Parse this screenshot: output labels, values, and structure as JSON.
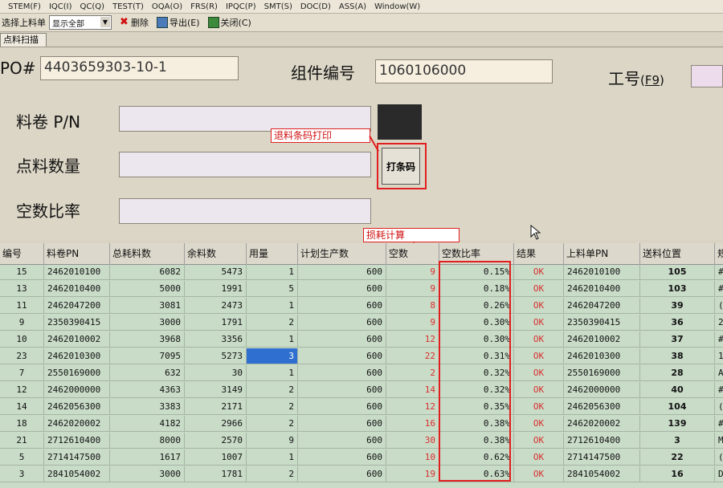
{
  "menu": [
    "STEM(F)",
    "IQC(I)",
    "QC(Q)",
    "TEST(T)",
    "OQA(O)",
    "FRS(R)",
    "IPQC(P)",
    "SMT(S)",
    "DOC(D)",
    "ASS(A)",
    "Window(W)"
  ],
  "toolbar": {
    "select_label": "选择上料单",
    "filter_value": "显示全部",
    "delete_label": "删除",
    "export_label": "导出(E)",
    "close_label": "关闭(C)"
  },
  "tab_label": "点料扫描",
  "form": {
    "po_label": "PO#",
    "po_value": "4403659303-10-1",
    "component_label": "组件编号",
    "component_value": "1060106000",
    "worker_label": "工号",
    "worker_hotkey": "F9",
    "reel_pn_label": "料卷 P/N",
    "count_label": "点料数量",
    "ratio_label": "空数比率",
    "print_button": "打条码"
  },
  "callouts": {
    "print_note": "退料条码打印",
    "calc_note": "损耗计算"
  },
  "table": {
    "headers": [
      "编号",
      "料卷PN",
      "总耗料数",
      "余料数",
      "用量",
      "计划生产数",
      "空数",
      "空数比率",
      "结果",
      "上料单PN",
      "送料位置",
      "规"
    ],
    "rows": [
      [
        "15",
        "2462010100",
        "6082",
        "5473",
        "1",
        "600",
        "9",
        "0.15%",
        "OK",
        "2462010100",
        "105",
        "#"
      ],
      [
        "13",
        "2462010400",
        "5000",
        "1991",
        "5",
        "600",
        "9",
        "0.18%",
        "OK",
        "2462010400",
        "103",
        "#"
      ],
      [
        "11",
        "2462047200",
        "3081",
        "2473",
        "1",
        "600",
        "8",
        "0.26%",
        "OK",
        "2462047200",
        "39",
        "("
      ],
      [
        "9",
        "2350390415",
        "3000",
        "1791",
        "2",
        "600",
        "9",
        "0.30%",
        "OK",
        "2350390415",
        "36",
        "2"
      ],
      [
        "10",
        "2462010002",
        "3968",
        "3356",
        "1",
        "600",
        "12",
        "0.30%",
        "OK",
        "2462010002",
        "37",
        "#"
      ],
      [
        "23",
        "2462010300",
        "7095",
        "5273",
        "3",
        "600",
        "22",
        "0.31%",
        "OK",
        "2462010300",
        "38",
        "1"
      ],
      [
        "7",
        "2550169000",
        "632",
        "30",
        "1",
        "600",
        "2",
        "0.32%",
        "OK",
        "2550169000",
        "28",
        "A"
      ],
      [
        "12",
        "2462000000",
        "4363",
        "3149",
        "2",
        "600",
        "14",
        "0.32%",
        "OK",
        "2462000000",
        "40",
        "#"
      ],
      [
        "14",
        "2462056300",
        "3383",
        "2171",
        "2",
        "600",
        "12",
        "0.35%",
        "OK",
        "2462056300",
        "104",
        "("
      ],
      [
        "18",
        "2462020002",
        "4182",
        "2966",
        "2",
        "600",
        "16",
        "0.38%",
        "OK",
        "2462020002",
        "139",
        "#"
      ],
      [
        "21",
        "2712610400",
        "8000",
        "2570",
        "9",
        "600",
        "30",
        "0.38%",
        "OK",
        "2712610400",
        "3",
        "M"
      ],
      [
        "5",
        "2714147500",
        "1617",
        "1007",
        "1",
        "600",
        "10",
        "0.62%",
        "OK",
        "2714147500",
        "22",
        "("
      ],
      [
        "3",
        "2841054002",
        "3000",
        "1781",
        "2",
        "600",
        "19",
        "0.63%",
        "OK",
        "2841054002",
        "16",
        "D"
      ]
    ]
  },
  "colors": {
    "accent_red": "#e02020",
    "selection_blue": "#2e6fd0",
    "ok_red": "#d83030"
  }
}
